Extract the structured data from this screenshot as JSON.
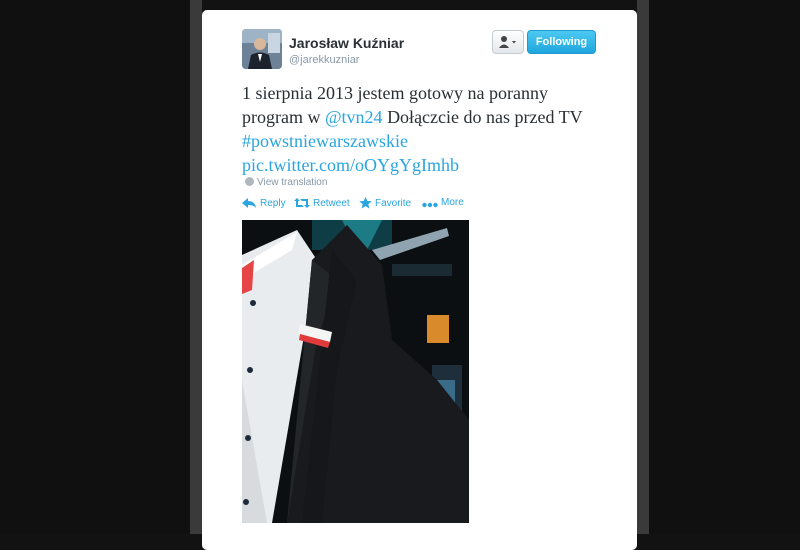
{
  "tweet": {
    "author_name": "Jarosław Kuźniar",
    "author_handle": "@jarekkuzniar",
    "follow_label": "Following",
    "text_part1": "1 sierpnia 2013 jestem gotowy na poranny program w ",
    "mention": "@tvn24",
    "text_part2": " Dołączcie do nas przed TV ",
    "hashtag": "#powstniewarszawskie",
    "pic_link": "pic.twitter.com/oOYgYgImhb",
    "view_translation": "View translation"
  },
  "actions": {
    "reply": "Reply",
    "retweet": "Retweet",
    "favorite": "Favorite",
    "more": "More"
  },
  "colors": {
    "link": "#2aa5e0",
    "follow_button": "#20a6dd",
    "text": "#292f33",
    "muted": "#8899a6"
  }
}
